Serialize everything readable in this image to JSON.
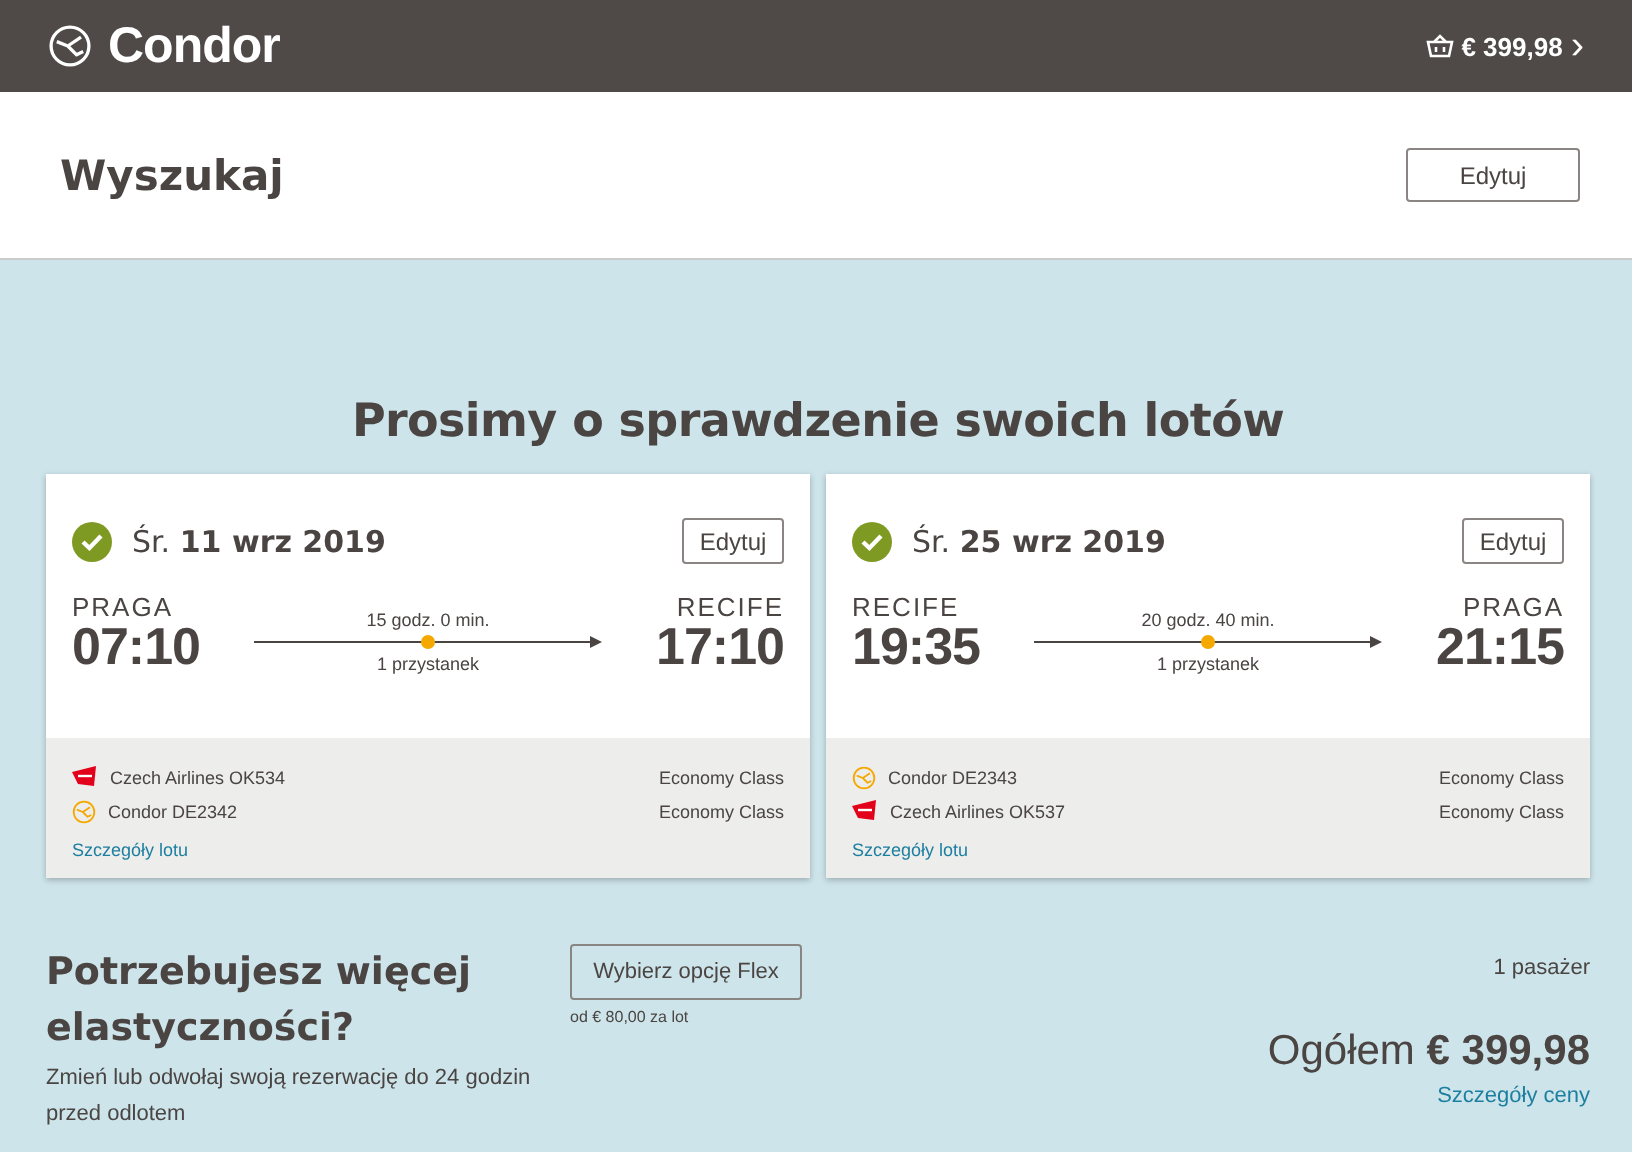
{
  "header": {
    "brand": "Condor",
    "cart_total": "€ 399,98",
    "chevron": "›"
  },
  "search_bar": {
    "title": "Wyszukaj",
    "edit_button": "Edytuj"
  },
  "heading": "Prosimy o sprawdzenie swoich lotów",
  "flights": [
    {
      "confirmed": true,
      "date": "Śr. **11 wrz 2019**",
      "edit_button": "Edytuj",
      "from": "PRAGA",
      "departure": "07:10",
      "duration": "15 godz. 0 min.",
      "stops": "1 przystanek",
      "to": "RECIFE",
      "arrival": "17:10",
      "segments": [
        {
          "kind": "czech",
          "flight": "Czech Airlines OK534",
          "cabin": "Economy Class"
        },
        {
          "kind": "condor",
          "flight": "Condor DE2342",
          "cabin": "Economy Class"
        }
      ],
      "details_link": "Szczegóły lotu"
    },
    {
      "confirmed": true,
      "date": "Śr. **25 wrz 2019**",
      "edit_button": "Edytuj",
      "from": "RECIFE",
      "departure": "19:35",
      "duration": "20 godz. 40 min.",
      "stops": "1 przystanek",
      "to": "PRAGA",
      "arrival": "21:15",
      "segments": [
        {
          "kind": "condor",
          "flight": "Condor DE2343",
          "cabin": "Economy Class"
        },
        {
          "kind": "czech",
          "flight": "Czech Airlines OK537",
          "cabin": "Economy Class"
        }
      ],
      "details_link": "Szczegóły lotu"
    }
  ],
  "flex": {
    "title": "Potrzebujesz więcej elastyczności?",
    "description": "Zmień lub odwołaj swoją rezerwację do 24 godzin przed odlotem",
    "button": "Wybierz opcję Flex",
    "price_note": "od € 80,00 za lot"
  },
  "summary": {
    "passengers": "1 pasażer",
    "total": "Ogółem **€ 399,98**",
    "details_link": "Szczegóły ceny"
  }
}
